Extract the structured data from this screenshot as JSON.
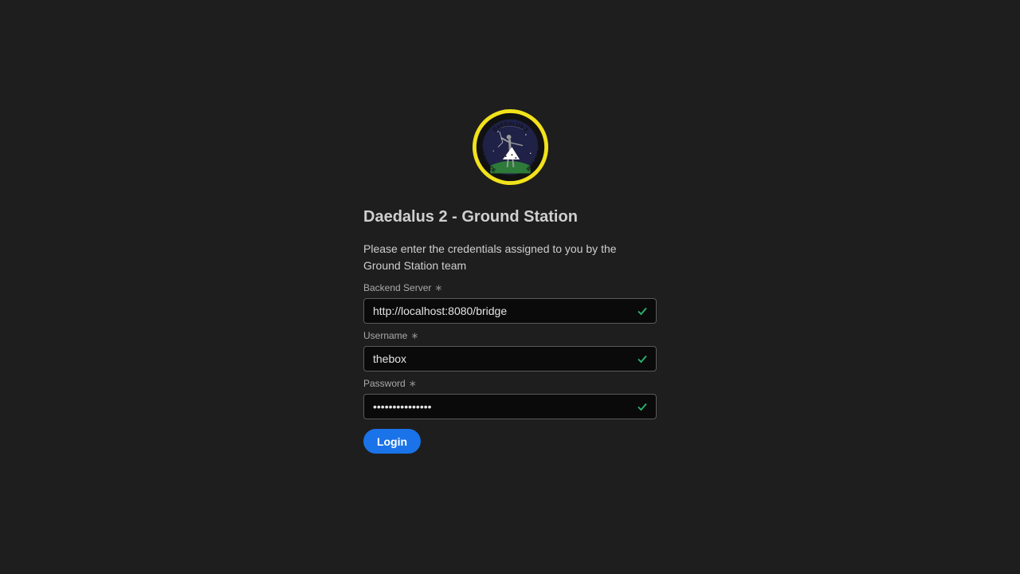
{
  "logo": {
    "text_top": "DAEDALUS 2",
    "text_left": "WUESPACE",
    "text_right": "REXUS 29",
    "ring_color": "#f2e21b",
    "center_color": "#1f2146"
  },
  "page": {
    "title": "Daedalus 2 - Ground Station",
    "description": "Please enter the credentials assigned to you by the Ground Station team"
  },
  "fields": {
    "server": {
      "label": "Backend Server",
      "required_mark": "∗",
      "value": "http://localhost:8080/bridge",
      "icon": "check-icon"
    },
    "username": {
      "label": "Username",
      "required_mark": "∗",
      "value": "thebox",
      "icon": "check-icon"
    },
    "password": {
      "label": "Password",
      "required_mark": "∗",
      "value": "•••••••••••••••",
      "icon": "check-icon"
    }
  },
  "actions": {
    "login_label": "Login"
  },
  "colors": {
    "background": "#1e1e1e",
    "accent": "#1a73e8",
    "valid": "#2bb673"
  }
}
